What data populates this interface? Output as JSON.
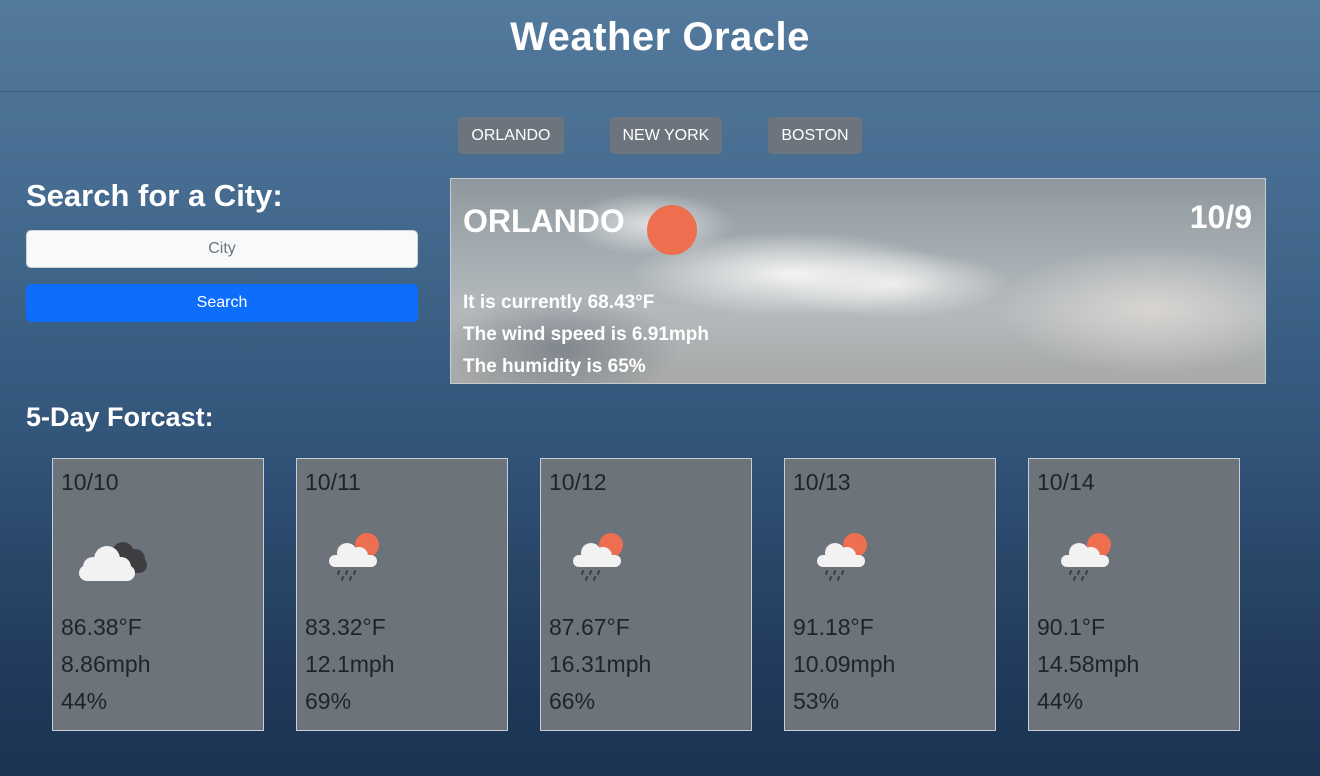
{
  "app": {
    "title": "Weather Oracle"
  },
  "quick_cities": [
    "ORLANDO",
    "NEW YORK",
    "BOSTON"
  ],
  "search": {
    "heading": "Search for a City:",
    "placeholder": "City",
    "button_label": "Search"
  },
  "current": {
    "city": "ORLANDO",
    "date": "10/9",
    "icon": "sun-icon",
    "sun_color": "#ee6e50",
    "temp_line": "It is currently 68.43°F",
    "wind_line": "The wind speed is 6.91mph",
    "humidity_line": "The humidity is 65%"
  },
  "forecast": {
    "title": "5-Day Forcast:",
    "days": [
      {
        "date": "10/10",
        "icon": "cloudy-icon",
        "temp": "86.38°F",
        "wind": "8.86mph",
        "humidity": "44%"
      },
      {
        "date": "10/11",
        "icon": "rain-sun-icon",
        "temp": "83.32°F",
        "wind": "12.1mph",
        "humidity": "69%"
      },
      {
        "date": "10/12",
        "icon": "rain-sun-icon",
        "temp": "87.67°F",
        "wind": "16.31mph",
        "humidity": "66%"
      },
      {
        "date": "10/13",
        "icon": "rain-sun-icon",
        "temp": "91.18°F",
        "wind": "10.09mph",
        "humidity": "53%"
      },
      {
        "date": "10/14",
        "icon": "rain-sun-icon",
        "temp": "90.1°F",
        "wind": "14.58mph",
        "humidity": "44%"
      }
    ]
  },
  "colors": {
    "primary_button": "#0d6efd",
    "secondary_button": "#6c757d",
    "card_bg": "#6c737b"
  }
}
